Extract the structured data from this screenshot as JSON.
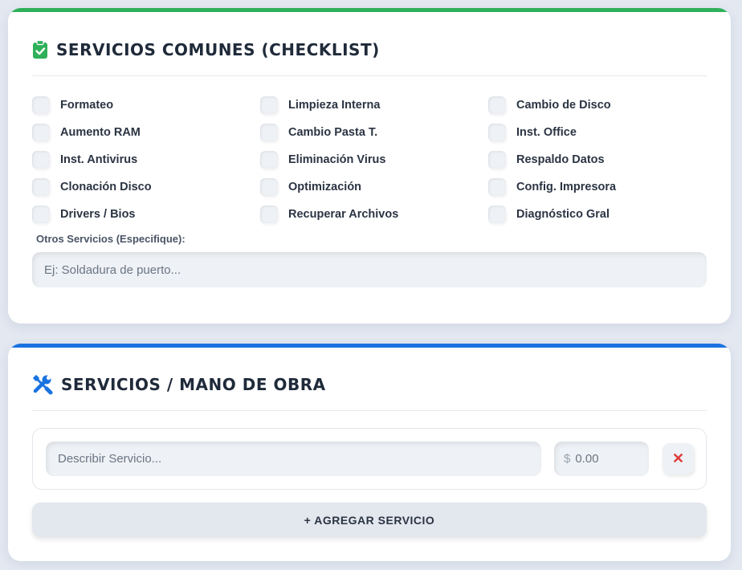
{
  "checklist_section": {
    "title": "SERVICIOS COMUNES (CHECKLIST)",
    "icon": "clipboard-check-icon",
    "accent_color": "#2fb05a",
    "items": [
      {
        "label": "Formateo",
        "checked": false
      },
      {
        "label": "Limpieza Interna",
        "checked": false
      },
      {
        "label": "Cambio de Disco",
        "checked": false
      },
      {
        "label": "Aumento RAM",
        "checked": false
      },
      {
        "label": "Cambio Pasta T.",
        "checked": false
      },
      {
        "label": "Inst. Office",
        "checked": false
      },
      {
        "label": "Inst. Antivirus",
        "checked": false
      },
      {
        "label": "Eliminación Virus",
        "checked": false
      },
      {
        "label": "Respaldo Datos",
        "checked": false
      },
      {
        "label": "Clonación Disco",
        "checked": false
      },
      {
        "label": "Optimización",
        "checked": false
      },
      {
        "label": "Config. Impresora",
        "checked": false
      },
      {
        "label": "Drivers / Bios",
        "checked": false
      },
      {
        "label": "Recuperar Archivos",
        "checked": false
      },
      {
        "label": "Diagnóstico Gral",
        "checked": false
      }
    ],
    "otros_label": "Otros Servicios (Especifique):",
    "otros_placeholder": "Ej: Soldadura de puerto...",
    "otros_value": ""
  },
  "labor_section": {
    "title": "SERVICIOS / MANO DE OBRA",
    "icon": "tools-icon",
    "accent_color": "#1a73e0",
    "row": {
      "description_placeholder": "Describir Servicio...",
      "description_value": "",
      "currency_symbol": "$",
      "price_placeholder": "0.00",
      "price_value": "",
      "remove_label": "✕"
    },
    "add_button_label": "+ AGREGAR SERVICIO"
  }
}
